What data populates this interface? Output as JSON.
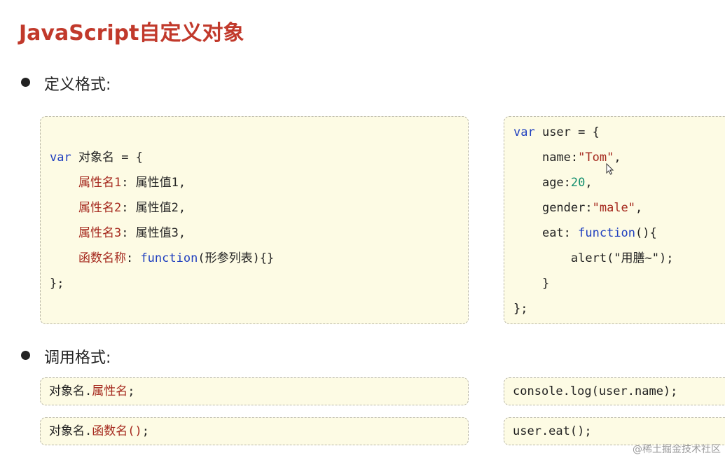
{
  "slide": {
    "title": "JavaScript自定义对象",
    "watermark": "@稀土掘金技术社区"
  },
  "define_section": {
    "label": "定义格式:",
    "template": {
      "kw_var": "var",
      "obj_name": " 对象名 = {",
      "prop1": "属性名1",
      "val1": ": 属性值1,",
      "prop2": "属性名2",
      "val2": ": 属性值2,",
      "prop3": "属性名3",
      "val3": ": 属性值3,",
      "func_name": "函数名称",
      "func_sep": ": ",
      "kw_function": "function",
      "func_params": "(形参列表){}",
      "close": "};"
    },
    "example": {
      "kw_var": "var",
      "head": " user = {",
      "name_key": "name:",
      "name_val": "\"Tom\"",
      "comma1": ",",
      "age_key": "age:",
      "age_val": "20",
      "comma2": ",",
      "gender_key": "gender:",
      "gender_val": "\"male\"",
      "comma3": ",",
      "eat_key": "eat: ",
      "kw_function": "function",
      "eat_paren": "(){",
      "alert_open": "alert(",
      "alert_str": "\"用膳~\"",
      "alert_close": ");",
      "inner_close": "}",
      "close": "};"
    }
  },
  "call_section": {
    "label": "调用格式:",
    "prop_call": {
      "obj": "对象名.",
      "prop": "属性名",
      "end": ";"
    },
    "func_call": {
      "obj": "对象名.",
      "func": "函数名()",
      "end": ";"
    },
    "example_prop": "console.log(user.name);",
    "example_func": "user.eat();"
  },
  "colors": {
    "title": "#c1392b",
    "keyword": "#1f3fbf",
    "property": "#a5291e",
    "number": "#138f6f",
    "box_bg": "#fdfbe4"
  }
}
